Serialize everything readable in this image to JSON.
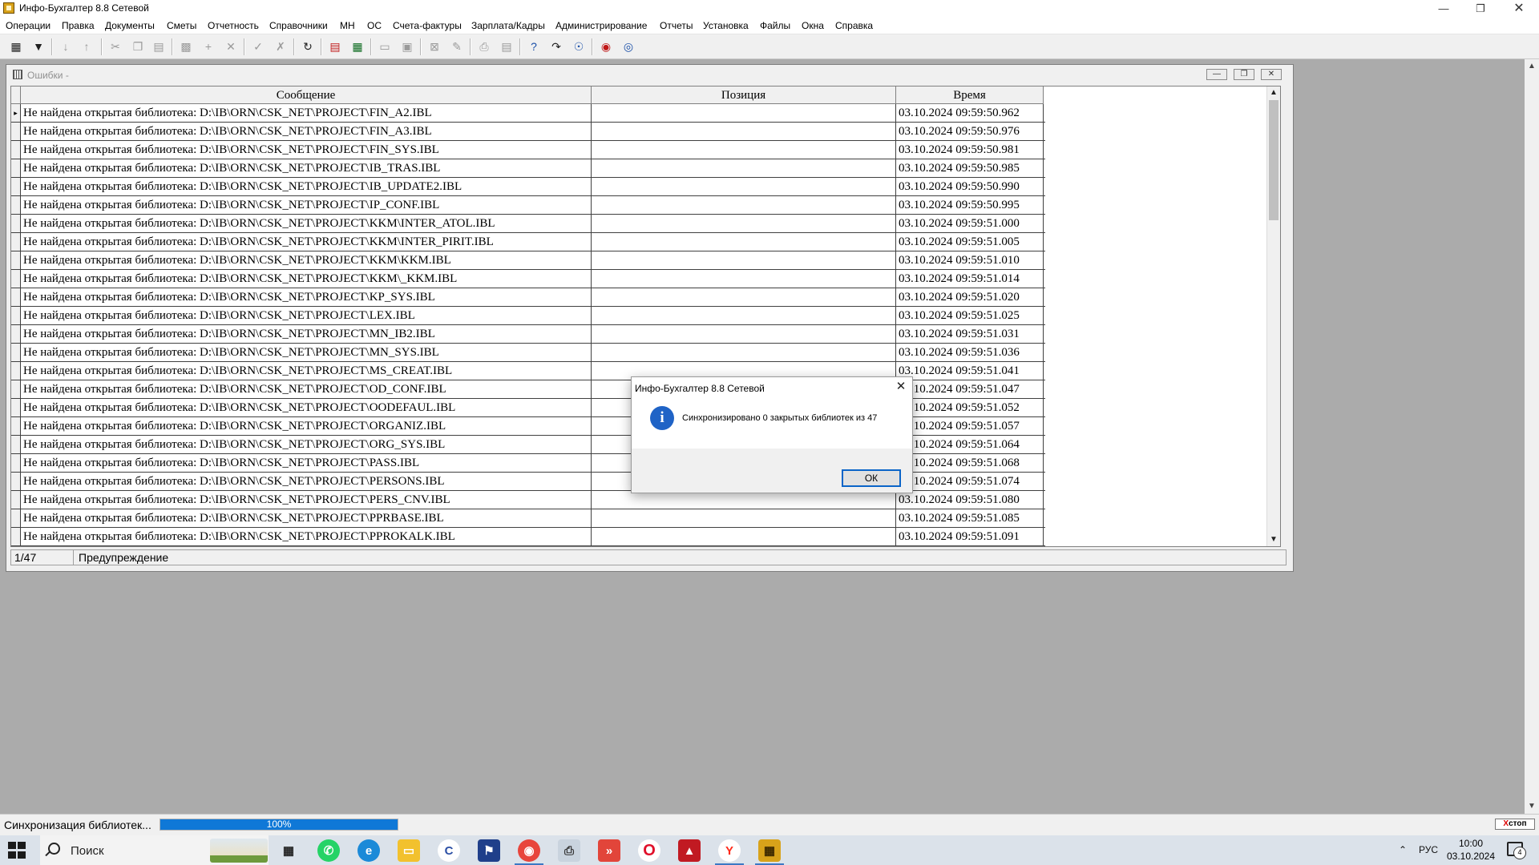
{
  "window": {
    "title": "Инфо-Бухгалтер 8.8 Сетевой"
  },
  "menu": [
    "Операции",
    "Правка",
    "Документы",
    "Сметы",
    "Отчетность",
    "Справочники",
    "МН",
    "ОС",
    "Счета-фактуры",
    "Зарплата/Кадры",
    "Администрирование",
    "Отчеты",
    "Установка",
    "Файлы",
    "Окна",
    "Справка"
  ],
  "child_window": {
    "title": "Ошибки -"
  },
  "grid": {
    "columns": [
      "Сообщение",
      "Позиция",
      "Время"
    ],
    "rows": [
      {
        "message": "Не найдена открытая библиотека: D:\\IB\\ORN\\CSK_NET\\PROJECT\\FIN_A2.IBL",
        "position": "",
        "time": "03.10.2024 09:59:50.962"
      },
      {
        "message": "Не найдена открытая библиотека: D:\\IB\\ORN\\CSK_NET\\PROJECT\\FIN_A3.IBL",
        "position": "",
        "time": "03.10.2024 09:59:50.976"
      },
      {
        "message": "Не найдена открытая библиотека: D:\\IB\\ORN\\CSK_NET\\PROJECT\\FIN_SYS.IBL",
        "position": "",
        "time": "03.10.2024 09:59:50.981"
      },
      {
        "message": "Не найдена открытая библиотека: D:\\IB\\ORN\\CSK_NET\\PROJECT\\IB_TRAS.IBL",
        "position": "",
        "time": "03.10.2024 09:59:50.985"
      },
      {
        "message": "Не найдена открытая библиотека: D:\\IB\\ORN\\CSK_NET\\PROJECT\\IB_UPDATE2.IBL",
        "position": "",
        "time": "03.10.2024 09:59:50.990"
      },
      {
        "message": "Не найдена открытая библиотека: D:\\IB\\ORN\\CSK_NET\\PROJECT\\IP_CONF.IBL",
        "position": "",
        "time": "03.10.2024 09:59:50.995"
      },
      {
        "message": "Не найдена открытая библиотека: D:\\IB\\ORN\\CSK_NET\\PROJECT\\KKM\\INTER_ATOL.IBL",
        "position": "",
        "time": "03.10.2024 09:59:51.000"
      },
      {
        "message": "Не найдена открытая библиотека: D:\\IB\\ORN\\CSK_NET\\PROJECT\\KKM\\INTER_PIRIT.IBL",
        "position": "",
        "time": "03.10.2024 09:59:51.005"
      },
      {
        "message": "Не найдена открытая библиотека: D:\\IB\\ORN\\CSK_NET\\PROJECT\\KKM\\KKM.IBL",
        "position": "",
        "time": "03.10.2024 09:59:51.010"
      },
      {
        "message": "Не найдена открытая библиотека: D:\\IB\\ORN\\CSK_NET\\PROJECT\\KKM\\_KKM.IBL",
        "position": "",
        "time": "03.10.2024 09:59:51.014"
      },
      {
        "message": "Не найдена открытая библиотека: D:\\IB\\ORN\\CSK_NET\\PROJECT\\KP_SYS.IBL",
        "position": "",
        "time": "03.10.2024 09:59:51.020"
      },
      {
        "message": "Не найдена открытая библиотека: D:\\IB\\ORN\\CSK_NET\\PROJECT\\LEX.IBL",
        "position": "",
        "time": "03.10.2024 09:59:51.025"
      },
      {
        "message": "Не найдена открытая библиотека: D:\\IB\\ORN\\CSK_NET\\PROJECT\\MN_IB2.IBL",
        "position": "",
        "time": "03.10.2024 09:59:51.031"
      },
      {
        "message": "Не найдена открытая библиотека: D:\\IB\\ORN\\CSK_NET\\PROJECT\\MN_SYS.IBL",
        "position": "",
        "time": "03.10.2024 09:59:51.036"
      },
      {
        "message": "Не найдена открытая библиотека: D:\\IB\\ORN\\CSK_NET\\PROJECT\\MS_CREAT.IBL",
        "position": "",
        "time": "03.10.2024 09:59:51.041"
      },
      {
        "message": "Не найдена открытая библиотека: D:\\IB\\ORN\\CSK_NET\\PROJECT\\OD_CONF.IBL",
        "position": "",
        "time": "03.10.2024 09:59:51.047"
      },
      {
        "message": "Не найдена открытая библиотека: D:\\IB\\ORN\\CSK_NET\\PROJECT\\OODEFAUL.IBL",
        "position": "",
        "time": "03.10.2024 09:59:51.052"
      },
      {
        "message": "Не найдена открытая библиотека: D:\\IB\\ORN\\CSK_NET\\PROJECT\\ORGANIZ.IBL",
        "position": "",
        "time": "03.10.2024 09:59:51.057"
      },
      {
        "message": "Не найдена открытая библиотека: D:\\IB\\ORN\\CSK_NET\\PROJECT\\ORG_SYS.IBL",
        "position": "",
        "time": "03.10.2024 09:59:51.064"
      },
      {
        "message": "Не найдена открытая библиотека: D:\\IB\\ORN\\CSK_NET\\PROJECT\\PASS.IBL",
        "position": "",
        "time": "03.10.2024 09:59:51.068"
      },
      {
        "message": "Не найдена открытая библиотека: D:\\IB\\ORN\\CSK_NET\\PROJECT\\PERSONS.IBL",
        "position": "",
        "time": "03.10.2024 09:59:51.074"
      },
      {
        "message": "Не найдена открытая библиотека: D:\\IB\\ORN\\CSK_NET\\PROJECT\\PERS_CNV.IBL",
        "position": "",
        "time": "03.10.2024 09:59:51.080"
      },
      {
        "message": "Не найдена открытая библиотека: D:\\IB\\ORN\\CSK_NET\\PROJECT\\PPRBASE.IBL",
        "position": "",
        "time": "03.10.2024 09:59:51.085"
      },
      {
        "message": "Не найдена открытая библиотека: D:\\IB\\ORN\\CSK_NET\\PROJECT\\PPROKALK.IBL",
        "position": "",
        "time": "03.10.2024 09:59:51.091"
      }
    ]
  },
  "grid_status": {
    "counter": "1/47",
    "type": "Предупреждение"
  },
  "dialog": {
    "title": "Инфо-Бухгалтер 8.8 Сетевой",
    "message": "Синхронизировано 0 закрытых библиотек из 47",
    "ok_label": "ОК",
    "icon": "info-icon"
  },
  "app_status": {
    "text": "Синхронизация библиотек...",
    "progress": 100,
    "progress_label": "100%",
    "stop_label": "стоп"
  },
  "taskbar": {
    "search_placeholder": "Поиск",
    "language": "РУС",
    "time": "10:00",
    "date": "03.10.2024",
    "notification_count": "4"
  },
  "colors": {
    "accent": "#0f78d7",
    "dialog_icon": "#1f63c6",
    "desktop": "#ababab"
  }
}
